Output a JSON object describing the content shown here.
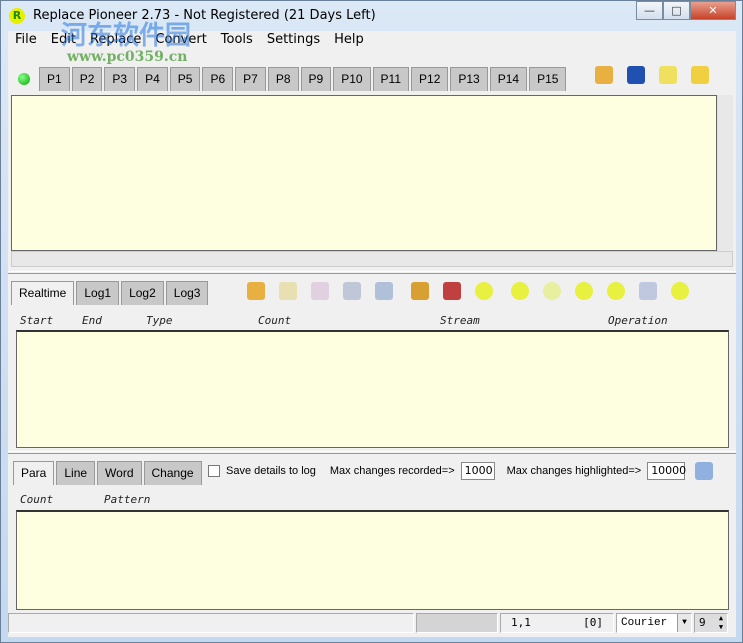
{
  "window": {
    "title": "Replace Pioneer 2.73 - Not Registered (21 Days Left)",
    "app_icon": "R",
    "minimize": "—",
    "maximize": "□",
    "close": "✕"
  },
  "menu": [
    "File",
    "Edit",
    "Replace",
    "Convert",
    "Tools",
    "Settings",
    "Help"
  ],
  "pages": [
    "P1",
    "P2",
    "P3",
    "P4",
    "P5",
    "P6",
    "P7",
    "P8",
    "P9",
    "P10",
    "P11",
    "P12",
    "P13",
    "P14",
    "P15"
  ],
  "log": {
    "tabs": [
      "Realtime",
      "Log1",
      "Log2",
      "Log3"
    ],
    "columns": [
      "Start",
      "End",
      "Type",
      "Count",
      "Stream",
      "Operation"
    ]
  },
  "pattern": {
    "tabs": [
      "Para",
      "Line",
      "Word",
      "Change"
    ],
    "save_details_label": "Save details to log",
    "save_details_checked": false,
    "max_recorded_label": "Max changes recorded=>",
    "max_recorded": "1000",
    "max_highlighted_label": "Max changes highlighted=>",
    "max_highlighted": "10000",
    "columns": [
      "Count",
      "Pattern"
    ]
  },
  "status": {
    "position": "1,1",
    "count": "[0]",
    "font": "Courier",
    "size": "9"
  },
  "watermark": {
    "text": "河东软件园",
    "url": "www.pc0359.cn"
  }
}
